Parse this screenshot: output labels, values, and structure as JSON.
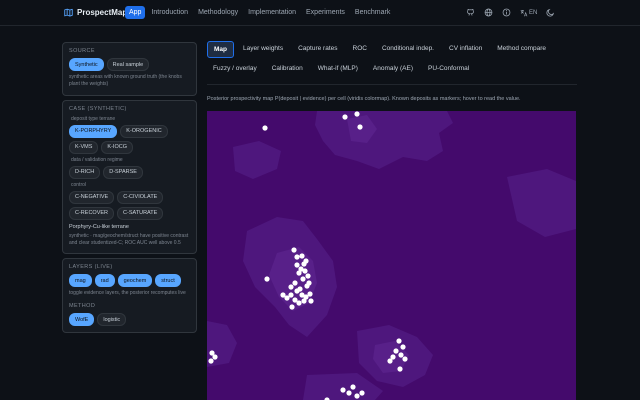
{
  "app": {
    "title": "ProspectMap"
  },
  "nav": {
    "items": [
      "App",
      "Introduction",
      "Methodology",
      "Implementation",
      "Experiments",
      "Benchmark"
    ],
    "active": 0
  },
  "top_icons": [
    "github-icon",
    "globe-icon",
    "info-icon",
    "translate-icon",
    "moon-icon"
  ],
  "lang_label": "EN",
  "source": {
    "title": "SOURCE",
    "options": [
      "Synthetic",
      "Real sample"
    ],
    "selected": "Synthetic",
    "note": "synthetic areas with known ground truth (the knobs plant the weights)"
  },
  "case": {
    "title": "CASE (SYNTHETIC)",
    "deposit_label": "deposit type terrane",
    "deposit_options": [
      "K-PORPHYRY",
      "K-OROGENIC",
      "K-VMS",
      "K-IOCG"
    ],
    "deposit_selected": "K-PORPHYRY",
    "regime_label": "data / validation regime",
    "regime_options": [
      "D-RICH",
      "D-SPARSE"
    ],
    "control_label": "control",
    "control_options": [
      "C-NEGATIVE",
      "C-CIVIOLATE",
      "C-RECOVER",
      "C-SATURATE"
    ],
    "case_title": "Porphyry-Cu-like terrane",
    "case_note": "synthetic · mag/geochem/struct have positive contrast and clear studentized-C; ROC AUC well above 0.5"
  },
  "layers": {
    "title": "LAYERS (LIVE)",
    "items": [
      "mag",
      "rad",
      "geochem",
      "struct"
    ],
    "note": "toggle evidence layers, the posterior recomputes live"
  },
  "method": {
    "title": "METHOD",
    "options": [
      "WofE",
      "logistic"
    ],
    "selected": "WofE"
  },
  "tabs": {
    "row1": [
      "Map",
      "Layer weights",
      "Capture rates",
      "ROC",
      "Conditional indep.",
      "CV inflation",
      "Method compare"
    ],
    "row2": [
      "Fuzzy / overlay",
      "Calibration",
      "What-if (MLP)",
      "Anomaly (AE)",
      "PU-Conformal"
    ],
    "active": "Map"
  },
  "caption": "Posterior prospectivity map P(deposit | evidence) per cell (viridis colormap). Known deposits as markers; hover to read the value.",
  "colors": {
    "accent": "#58a6ff",
    "nav_active": "#1f6feb",
    "map_low": "#440a6c",
    "map_mid": "#4e177d",
    "map_high": "#582089",
    "deposit_marker": "#ffffff"
  },
  "map_data": {
    "colormap": "viridis",
    "deposits_visible": 50
  }
}
